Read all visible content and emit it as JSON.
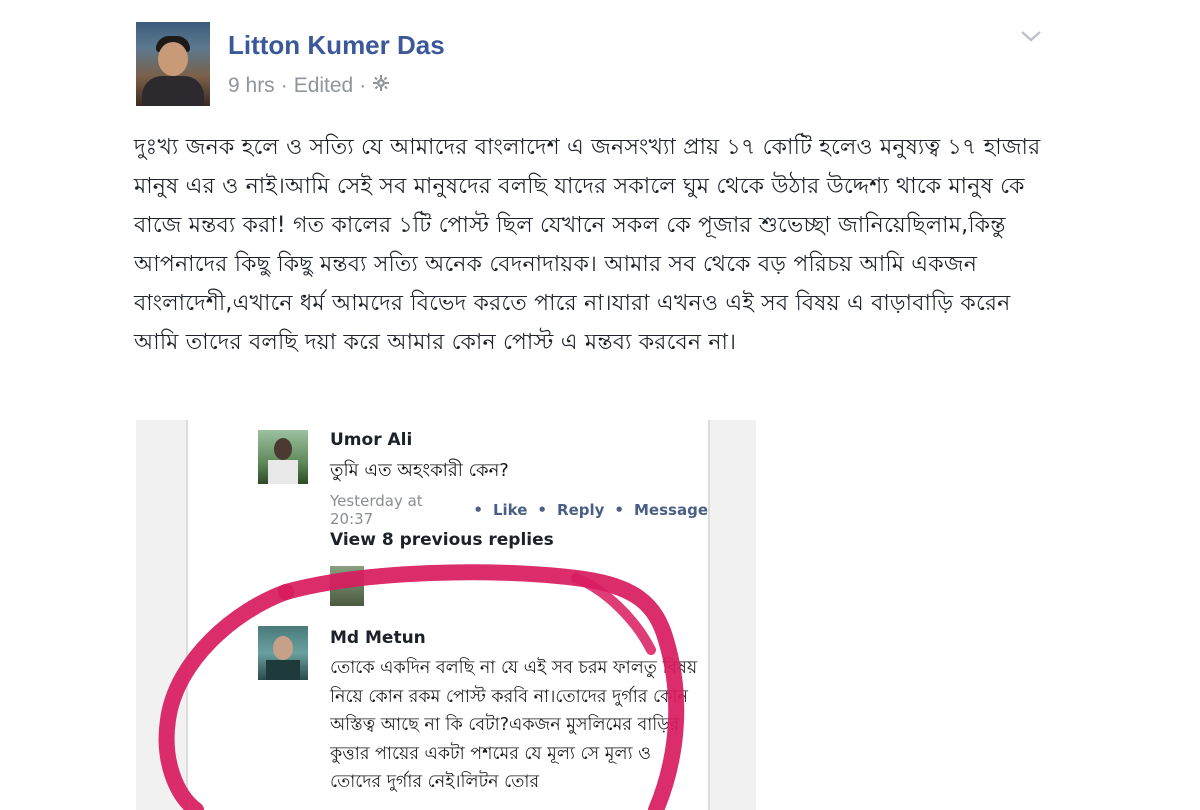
{
  "post": {
    "author": "Litton Kumer Das",
    "time": "9 hrs",
    "separator": "·",
    "edited": "Edited",
    "separator2": "·",
    "privacy_icon": "gear-icon",
    "menu_icon": "chevron-down-icon",
    "text": "দুঃখ্য জনক হলে ও সত্যি যে আমাদের বাংলাদেশ এ জনসংখ্যা প্রায় ১৭ কোটি হলেও মনুষ্যত্ব ১৭ হাজার মানুষ এর ও নাই।আমি সেই সব মানুষদের বলছি যাদের সকালে ঘুম থেকে উঠার উদ্দেশ্য থাকে মানুষ কে বাজে মন্তব্য করা! গত কালের ১টি পোস্ট ছিল যেখানে সকল কে পূজার শুভেচ্ছা জানিয়েছিলাম,কিন্তু আপনাদের কিছু কিছু মন্তব্য সত্যি অনেক বেদনাদায়ক। আমার সব থেকে বড় পরিচয় আমি একজন বাংলাদেশী,এখানে ধর্ম আমদের বিভেদ করতে পারে না।যারা এখনও এই সব বিষয় এ বাড়াবাড়ি করেন আমি তাদের বলছি দয়া করে আমার কোন পোস্ট এ মন্তব্য করবেন না।"
  },
  "screenshot": {
    "comment1": {
      "name": "Umor Ali",
      "text": "তুমি এত অহংকারী কেন?",
      "time": "Yesterday at 20:37",
      "like": "Like",
      "reply": "Reply",
      "message": "Message",
      "dot": "•"
    },
    "view_previous": "View 8 previous replies",
    "comment2": {
      "name": "Md Metun",
      "text": "তোকে একদিন বলছি না যে এই সব চরম ফালতু বিষয় নিয়ে কোন রকম পোস্ট করবি না।তোদের দুর্গার কোন অস্তিত্ব আছে না কি বেটা?একজন মুসলিমের বাড়ির কুত্তার পায়ের একটা পশমের যে মূল্য সে মূল্য ও তোদের দুর্গার নেই।লিটন তোর"
    },
    "highlight_color": "#d81b60"
  }
}
